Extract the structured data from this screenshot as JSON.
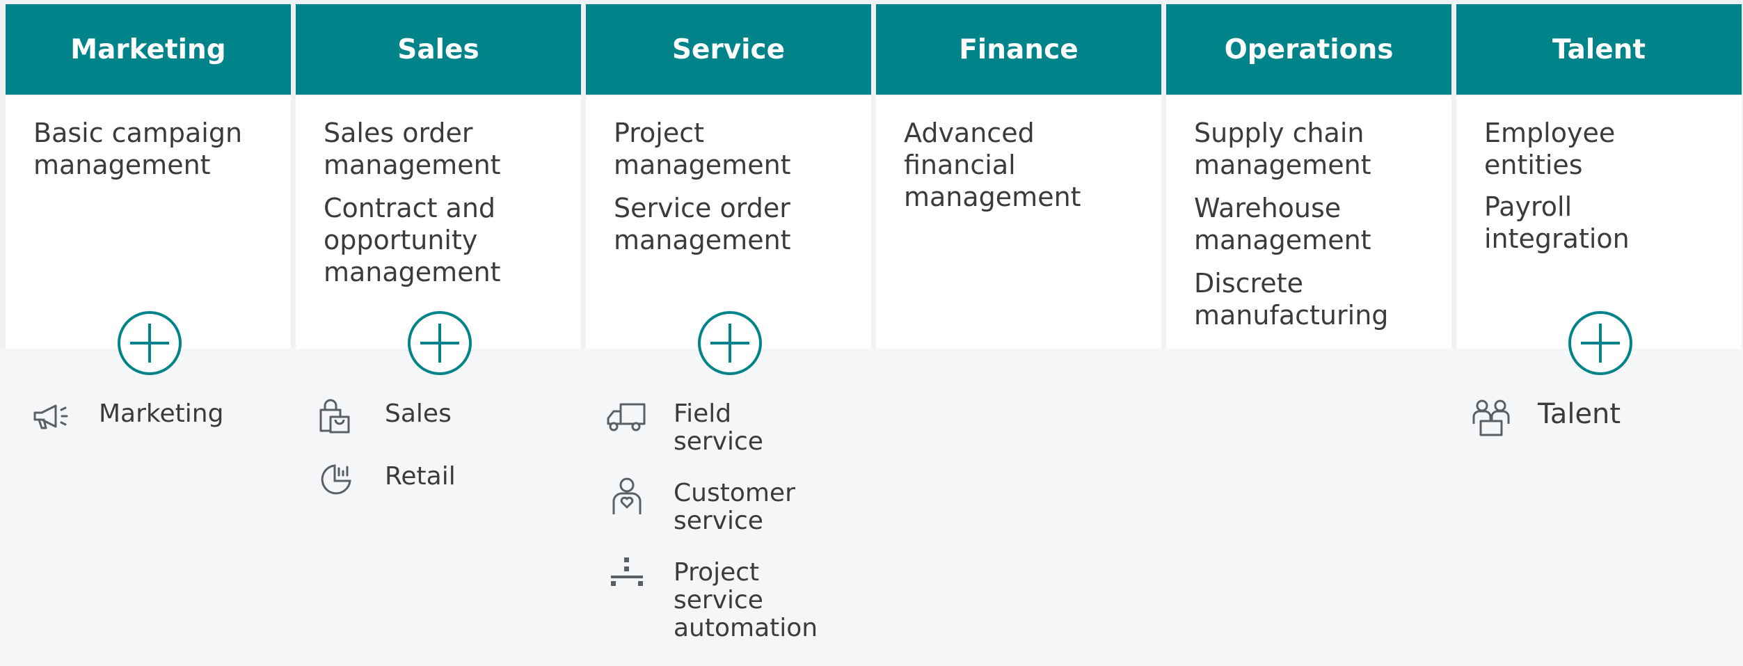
{
  "columns": [
    {
      "header": "Marketing",
      "capabilities": [
        "Basic campaign management"
      ],
      "has_plus": true
    },
    {
      "header": "Sales",
      "capabilities": [
        "Sales order management",
        "Contract and opportunity management"
      ],
      "has_plus": true
    },
    {
      "header": "Service",
      "capabilities": [
        "Project management",
        "Service order management"
      ],
      "has_plus": true
    },
    {
      "header": "Finance",
      "capabilities": [
        "Advanced financial management"
      ],
      "has_plus": false
    },
    {
      "header": "Operations",
      "capabilities": [
        "Supply chain management",
        "Warehouse management",
        "Discrete manufacturing"
      ],
      "has_plus": false
    },
    {
      "header": "Talent",
      "capabilities": [
        "Employee entities",
        "Payroll integration"
      ],
      "has_plus": true
    }
  ],
  "apps": {
    "marketing": [
      {
        "label": "Marketing",
        "icon": "megaphone-icon"
      }
    ],
    "sales": [
      {
        "label": "Sales",
        "icon": "shopping-bag-icon"
      },
      {
        "label": "Retail",
        "icon": "pie-chart-icon"
      }
    ],
    "service": [
      {
        "label": "Field service",
        "icon": "truck-icon"
      },
      {
        "label": "Customer service",
        "icon": "person-heart-icon"
      },
      {
        "label": "Project service automation",
        "icon": "hierarchy-icon"
      }
    ],
    "talent": [
      {
        "label": "Talent",
        "icon": "people-icon"
      }
    ]
  },
  "colors": {
    "header": "#008489",
    "text": "#3b3b3b",
    "icon": "#5a5f66",
    "background": "#f4f6f8"
  }
}
